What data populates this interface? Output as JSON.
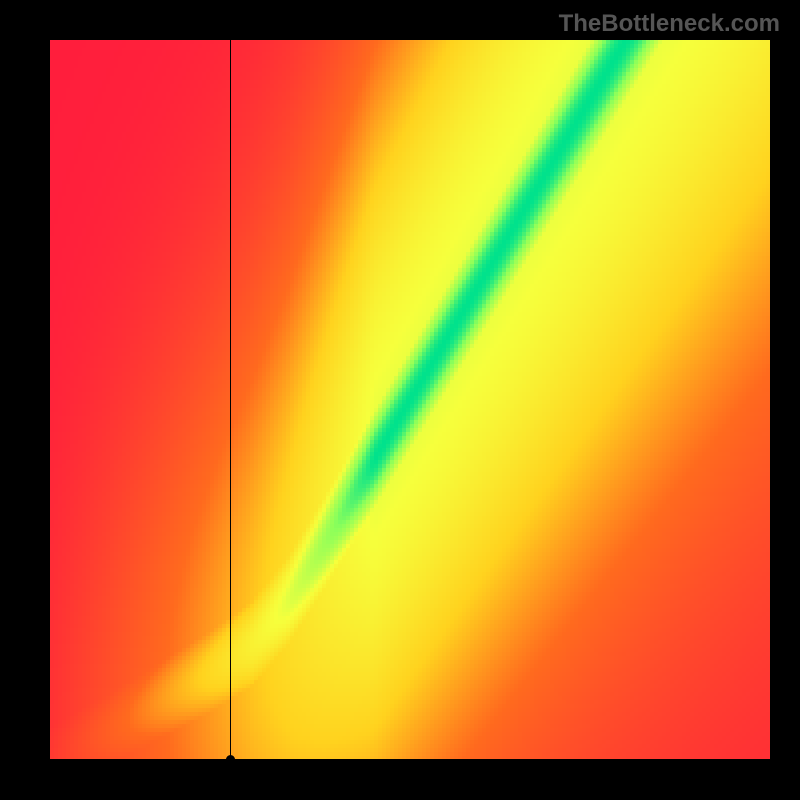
{
  "watermark": "TheBottleneck.com",
  "chart_data": {
    "type": "heatmap",
    "title": "",
    "xlabel": "",
    "ylabel": "",
    "xlim": [
      0,
      100
    ],
    "ylim": [
      0,
      100
    ],
    "grid": false,
    "legend": "none",
    "description": "Pixelated bottleneck heatmap. Value 0 = green (optimal match along a curved ridge from bottom-left rising steeply to upper-right), transitioning through yellow/orange to red at the extremes. A thin vertical black guide line at x≈25 meets the x-axis with a black marker dot.",
    "color_scale": {
      "0.00": "#ff1e3c",
      "0.35": "#ff6a1e",
      "0.55": "#ffd21e",
      "0.75": "#f6ff3c",
      "0.90": "#8cff5a",
      "1.00": "#00e28c"
    },
    "ridge_points": [
      {
        "x": 0,
        "y": 0
      },
      {
        "x": 8,
        "y": 4
      },
      {
        "x": 15,
        "y": 8
      },
      {
        "x": 22,
        "y": 12
      },
      {
        "x": 28,
        "y": 16
      },
      {
        "x": 33,
        "y": 22
      },
      {
        "x": 38,
        "y": 30
      },
      {
        "x": 44,
        "y": 40
      },
      {
        "x": 50,
        "y": 50
      },
      {
        "x": 56,
        "y": 60
      },
      {
        "x": 62,
        "y": 70
      },
      {
        "x": 68,
        "y": 80
      },
      {
        "x": 74,
        "y": 90
      },
      {
        "x": 80,
        "y": 100
      }
    ],
    "guide_x": 25,
    "guide_marker_y": 0
  }
}
